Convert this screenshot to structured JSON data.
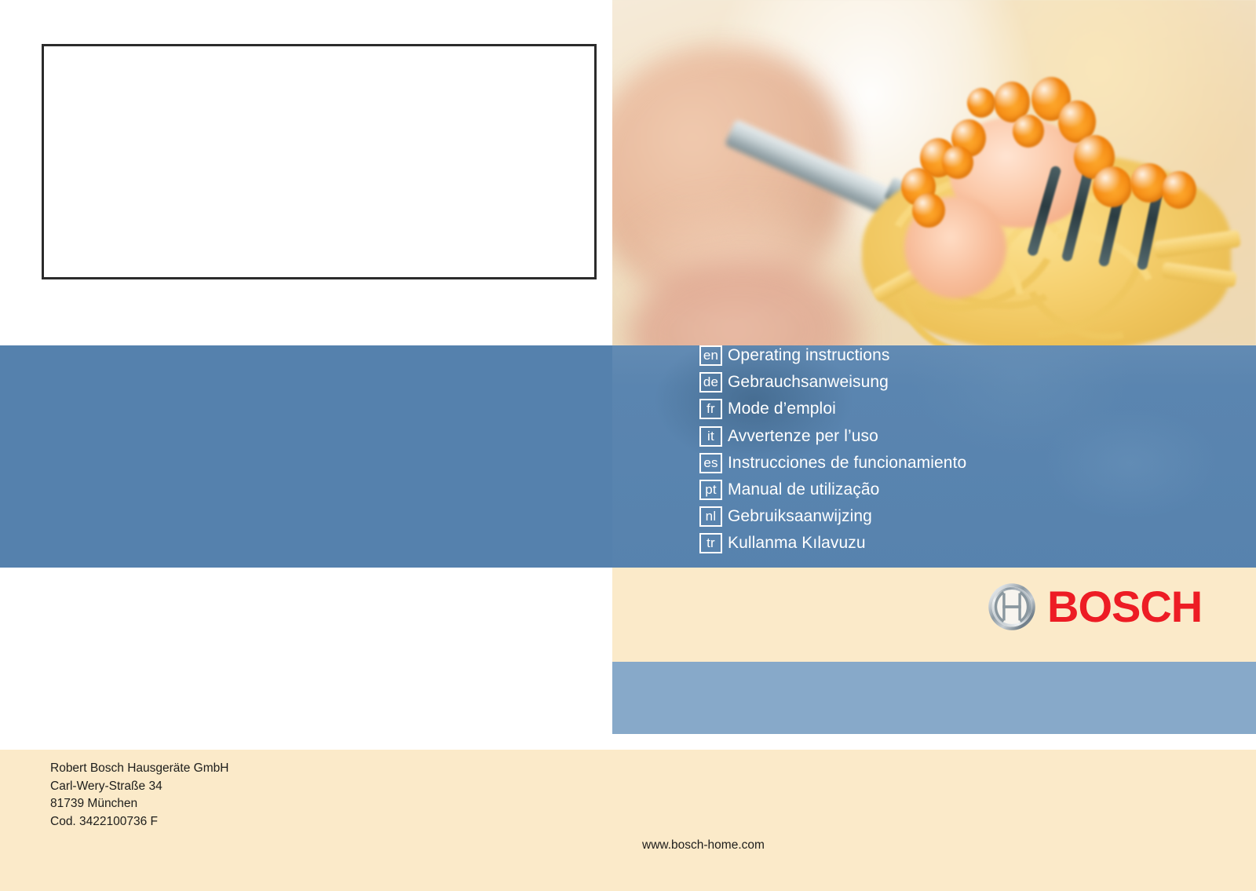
{
  "document": {
    "type": "appliance-manual-cover",
    "brand": "BOSCH"
  },
  "title_box": {
    "content": ""
  },
  "photo": {
    "alt": "Close-up of a person eating spaghetti with salmon and orange fish roe on a fork"
  },
  "languages": [
    {
      "code": "en",
      "title": "Operating  instructions"
    },
    {
      "code": "de",
      "title": "Gebrauchsanweisung"
    },
    {
      "code": "fr",
      "title": "Mode d’emploi"
    },
    {
      "code": "it",
      "title": "Avvertenze per l’uso"
    },
    {
      "code": "es",
      "title": "Instrucciones de funcionamiento"
    },
    {
      "code": "pt",
      "title": "Manual de utilização"
    },
    {
      "code": "nl",
      "title": "Gebruiksaanwijzing"
    },
    {
      "code": "tr",
      "title": "Kullanma Kılavuzu"
    }
  ],
  "logo": {
    "wordmark": "BOSCH",
    "symbol": "bosch-armature-icon"
  },
  "address": {
    "line1": "Robert Bosch Hausgeräte GmbH",
    "line2": "Carl-Wery-Straße 34",
    "line3": "81739 München",
    "line4": "Cod. 3422100736 F"
  },
  "footer": {
    "website": "www.bosch-home.com"
  },
  "colors": {
    "blue_band": "#5581AD",
    "light_blue_band": "#87A9C9",
    "cream": "#FBEAC9",
    "bosch_red": "#ED1C24",
    "box_border": "#2B2B2B",
    "text": "#1D1D1B"
  }
}
